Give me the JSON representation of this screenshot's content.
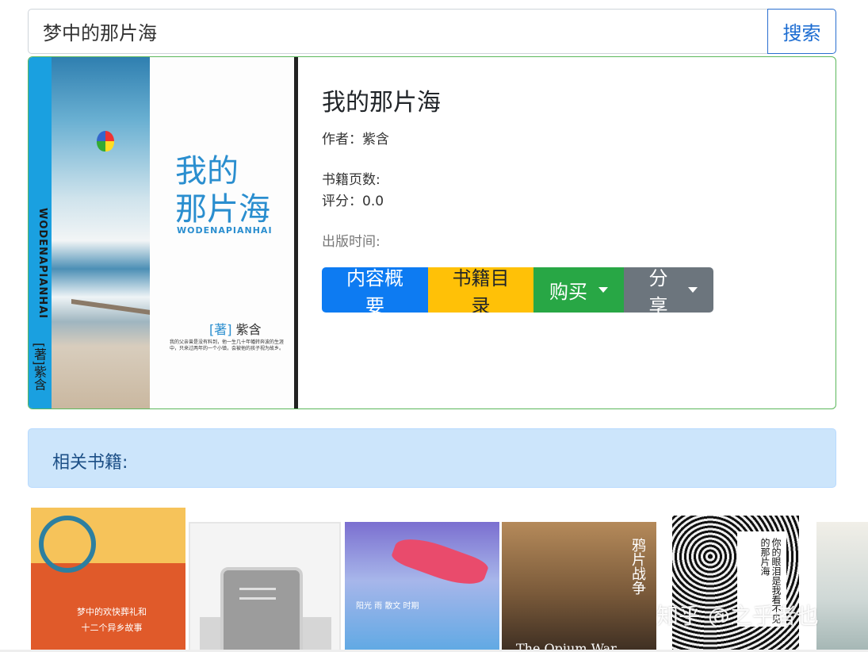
{
  "search": {
    "value": "梦中的那片海",
    "button_label": "搜索"
  },
  "book": {
    "title": "我的那片海",
    "author_label": "作者：",
    "author": "紫含",
    "pages_label": "书籍页数:",
    "pages": "",
    "rating_label": "评分：",
    "rating": "0.0",
    "publish_label": "出版时间:",
    "publish": "",
    "cover": {
      "title_line1": "我的",
      "title_line2": "那片海",
      "subtitle": "WODENAPIANHAI",
      "spine_text": "WODENAPIANHAI",
      "spine_mark": "[著]",
      "spine_author": "紫含",
      "author_mark": "[著]",
      "author": "紫含",
      "blurb": "我的父亲曾是没有料到，他一生几十年幡转奔波的生涯中，只来过两年的一个小镇，会被他的孩子视为故乡。"
    },
    "buttons": {
      "summary": "内容概要",
      "toc": "书籍目录",
      "buy": "购买",
      "share": "分享"
    },
    "colors": {
      "summary": "#0d7bf2",
      "toc": "#ffc107",
      "buy": "#28a745",
      "share": "#6c757d"
    }
  },
  "related": {
    "label": "相关书籍:",
    "thumbs": [
      {
        "text_line1": "梦中的欢快葬礼和",
        "text_line2": "十二个异乡故事"
      },
      {
        "text": ""
      },
      {
        "text": "阳光 雨 散文 时期"
      },
      {
        "title": "鸦片战争",
        "en": "The Opium War"
      },
      {
        "title": "你的眼泪是我看不见的那片海"
      },
      {
        "text": ""
      }
    ]
  },
  "watermark": "知乎 @之乎者也"
}
